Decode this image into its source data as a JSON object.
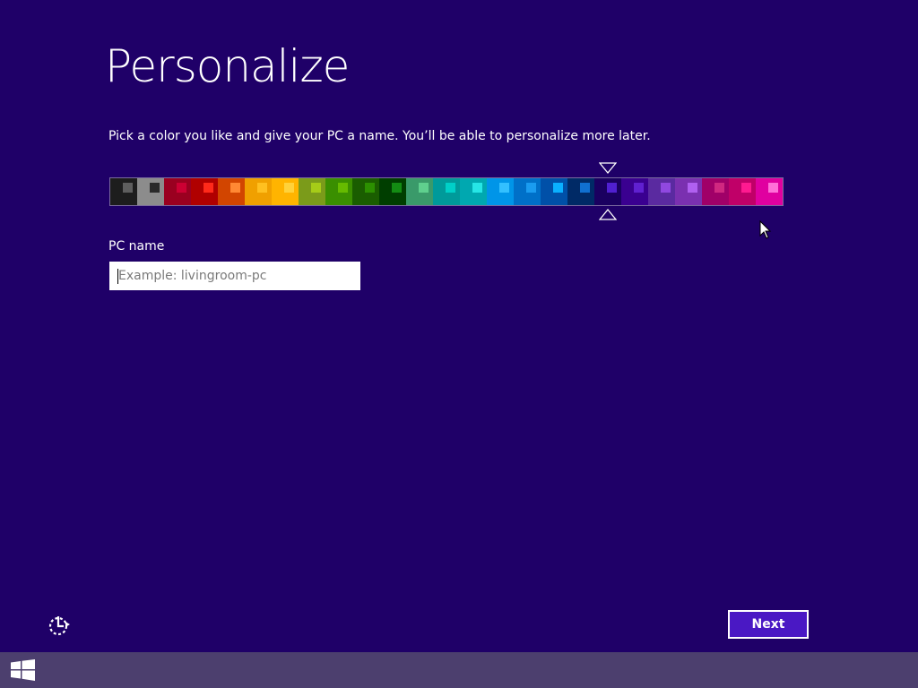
{
  "page": {
    "title": "Personalize",
    "subtitle": "Pick a color you like and give your PC a name. You’ll be able to personalize more later."
  },
  "palette": {
    "selected_index": 18,
    "swatches": [
      {
        "bg": "#1d1d1d",
        "accent": "#5e5e5e"
      },
      {
        "bg": "#8c8c8c",
        "accent": "#2a2a2a"
      },
      {
        "bg": "#9a0020",
        "accent": "#cc0033"
      },
      {
        "bg": "#b00000",
        "accent": "#ff2a1a"
      },
      {
        "bg": "#d24500",
        "accent": "#ff8833"
      },
      {
        "bg": "#f0a000",
        "accent": "#ffc020"
      },
      {
        "bg": "#ffb400",
        "accent": "#ffd23a"
      },
      {
        "bg": "#7b9b1a",
        "accent": "#a6cc18"
      },
      {
        "bg": "#3a8f00",
        "accent": "#66bb00"
      },
      {
        "bg": "#1a5d00",
        "accent": "#2c9000"
      },
      {
        "bg": "#003e00",
        "accent": "#138c13"
      },
      {
        "bg": "#3a9a6a",
        "accent": "#5fd08e"
      },
      {
        "bg": "#009a9a",
        "accent": "#00d0c8"
      },
      {
        "bg": "#00a8b0",
        "accent": "#26e6e6"
      },
      {
        "bg": "#0095e8",
        "accent": "#33c0ff"
      },
      {
        "bg": "#0070c8",
        "accent": "#1a9cf0"
      },
      {
        "bg": "#0050a8",
        "accent": "#0ab0ff"
      },
      {
        "bg": "#002a66",
        "accent": "#1070d0"
      },
      {
        "bg": "#1a0060",
        "accent": "#5020d0"
      },
      {
        "bg": "#3a0090",
        "accent": "#6020d0"
      },
      {
        "bg": "#5a2aa0",
        "accent": "#9048e0"
      },
      {
        "bg": "#7a30b0",
        "accent": "#b060f0"
      },
      {
        "bg": "#a00068",
        "accent": "#d02880"
      },
      {
        "bg": "#c00068",
        "accent": "#ff1a90"
      },
      {
        "bg": "#e000a0",
        "accent": "#ff70d8"
      }
    ]
  },
  "pc_name": {
    "label": "PC name",
    "placeholder": "Example: livingroom-pc",
    "value": ""
  },
  "buttons": {
    "next": "Next"
  },
  "icons": {
    "ease_of_access": "ease-of-access-icon",
    "windows_logo": "windows-logo-icon",
    "selection_marker": "triangle-marker-icon",
    "mouse_pointer": "mouse-pointer-icon"
  },
  "colors": {
    "background": "#1f0068",
    "taskbar": "#4c3f6e",
    "button": "#4a18c4"
  }
}
